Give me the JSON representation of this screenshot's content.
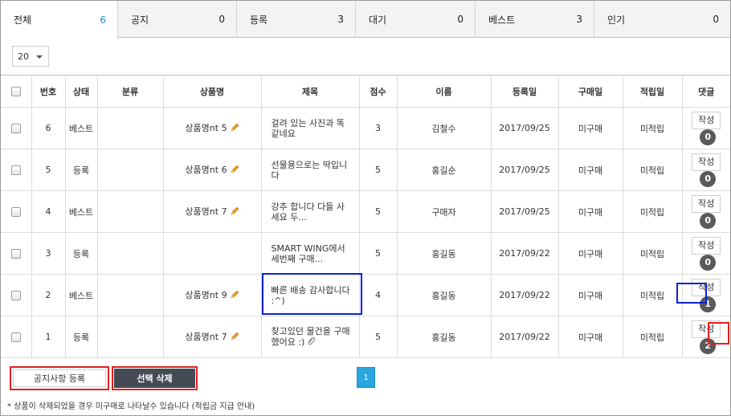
{
  "tabs": [
    {
      "label": "전체",
      "count": "6"
    },
    {
      "label": "공지",
      "count": "0"
    },
    {
      "label": "등록",
      "count": "3"
    },
    {
      "label": "대기",
      "count": "0"
    },
    {
      "label": "베스트",
      "count": "3"
    },
    {
      "label": "인기",
      "count": "0"
    }
  ],
  "per_page": {
    "value": "20"
  },
  "table": {
    "headers": {
      "no": "번호",
      "status": "상태",
      "category": "분류",
      "product": "상품명",
      "title": "제목",
      "score": "점수",
      "name": "이름",
      "reg_date": "등록일",
      "purchase": "구매일",
      "reward": "적립일",
      "reply": "댓글"
    },
    "rows": [
      {
        "no": "6",
        "status": "베스트",
        "category": "",
        "product": "상품명nt 5",
        "title": "걸려 있는 사진과 똑같네요",
        "score": "3",
        "name": "김철수",
        "reg_date": "2017/09/25",
        "purchase": "미구매",
        "reward": "미적립",
        "write": "작성",
        "reply_count": "0"
      },
      {
        "no": "5",
        "status": "등록",
        "category": "",
        "product": "상품명nt 6",
        "title": "선물용으로는 딱입니다",
        "score": "5",
        "name": "홍길순",
        "reg_date": "2017/09/25",
        "purchase": "미구매",
        "reward": "미적립",
        "write": "작성",
        "reply_count": "0"
      },
      {
        "no": "4",
        "status": "베스트",
        "category": "",
        "product": "상품명nt 7",
        "title": "강추 합니다 다들 사세요 두...",
        "score": "5",
        "name": "구매자",
        "reg_date": "2017/09/25",
        "purchase": "미구매",
        "reward": "미적립",
        "write": "작성",
        "reply_count": "0"
      },
      {
        "no": "3",
        "status": "등록",
        "category": "",
        "product": "",
        "title": "SMART WING에서 세번째 구매...",
        "score": "5",
        "name": "홍길동",
        "reg_date": "2017/09/22",
        "purchase": "미구매",
        "reward": "미적립",
        "write": "작성",
        "reply_count": "0"
      },
      {
        "no": "2",
        "status": "베스트",
        "category": "",
        "product": "상품명nt 9",
        "title": "빠른 배송 감사합니다 :^)",
        "score": "4",
        "name": "홍길동",
        "reg_date": "2017/09/22",
        "purchase": "미구매",
        "reward": "미적립",
        "write": "작성",
        "reply_count": "1"
      },
      {
        "no": "1",
        "status": "등록",
        "category": "",
        "product": "상품명nt 7",
        "title": "찾고있던 물건을 구매했어요 :)",
        "score": "5",
        "name": "홍길동",
        "reg_date": "2017/09/22",
        "purchase": "미구매",
        "reward": "미적립",
        "write": "작성",
        "reply_count": "2"
      }
    ]
  },
  "actions": {
    "notice_register": "공지사항 등록",
    "delete_selected": "선택 삭제"
  },
  "pagination": {
    "current": "1"
  },
  "footnote": "* 상품이 삭제되었을 경우 미구매로 나타날수 있습니다 (적립금 지급 안내)",
  "colors": {
    "accent": "#1a8fd6",
    "highlight_red": "#e02020",
    "highlight_blue": "#0a22d8",
    "badge": "#5a5a5a",
    "delete_btn": "#444b55",
    "page_active": "#2aa6e0"
  }
}
